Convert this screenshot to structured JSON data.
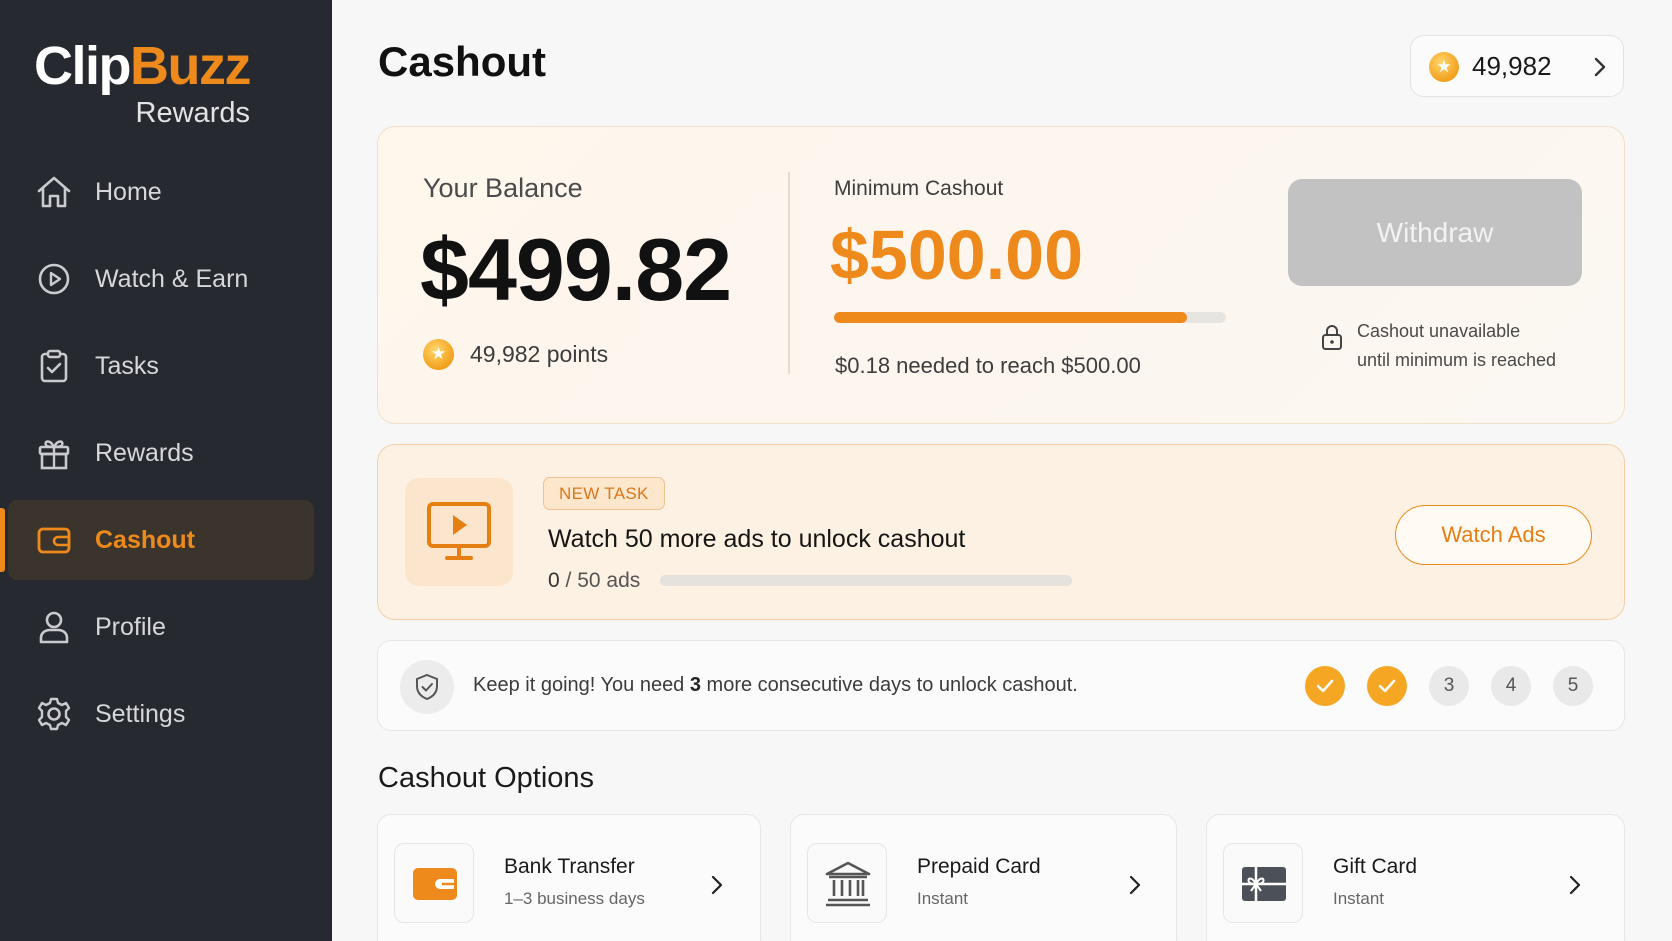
{
  "brand": {
    "name_part1": "Clip",
    "name_part2": "Buzz",
    "subtitle": "Rewards"
  },
  "sidebar": {
    "items": [
      {
        "label": "Home",
        "icon": "home-icon"
      },
      {
        "label": "Watch & Earn",
        "icon": "play-circle-icon"
      },
      {
        "label": "Tasks",
        "icon": "clipboard-check-icon"
      },
      {
        "label": "Rewards",
        "icon": "gift-icon"
      },
      {
        "label": "Cashout",
        "icon": "wallet-icon",
        "active": true
      },
      {
        "label": "Profile",
        "icon": "user-icon"
      },
      {
        "label": "Settings",
        "icon": "gear-icon"
      }
    ]
  },
  "header": {
    "title": "Cashout",
    "points": "49,982"
  },
  "balance": {
    "label": "Your Balance",
    "amount": "$499.82",
    "points_text": "49,982 points",
    "min_label": "Minimum Cashout",
    "min_amount": "$500.00",
    "progress_fraction": 0.9,
    "needed_text": "$0.18 needed to reach $500.00",
    "withdraw_label": "Withdraw",
    "lock_note_line1": "Cashout unavailable",
    "lock_note_line2": "until minimum is reached"
  },
  "task": {
    "tag": "NEW TASK",
    "title": "Watch 50 more ads to unlock cashout",
    "progress_done": "0",
    "progress_rest": " / 50 ads",
    "progress_fraction": 0,
    "button_label": "Watch Ads"
  },
  "streak": {
    "text_before": "Keep it going! You need ",
    "count": "3",
    "text_after": " more consecutive days to unlock cashout.",
    "days": [
      {
        "label": "",
        "done": true
      },
      {
        "label": "",
        "done": true
      },
      {
        "label": "3",
        "done": false
      },
      {
        "label": "4",
        "done": false
      },
      {
        "label": "5",
        "done": false
      }
    ]
  },
  "options": {
    "title": "Cashout Options",
    "items": [
      {
        "name": "Bank Transfer",
        "sub": "1–3 business days",
        "icon": "wallet-icon"
      },
      {
        "name": "Prepaid Card",
        "sub": "Instant",
        "icon": "bank-icon"
      },
      {
        "name": "Gift Card",
        "sub": "Instant",
        "icon": "gift-card-icon"
      }
    ]
  },
  "colors": {
    "accent": "#ee8a1c",
    "sidebar_bg": "#262a30",
    "disabled_button": "#c2c2c2"
  }
}
